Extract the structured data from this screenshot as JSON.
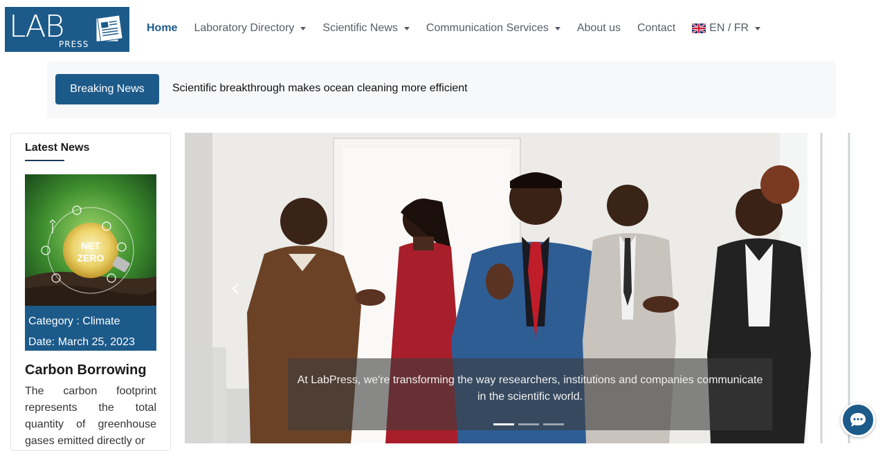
{
  "logo": {
    "letters": "LAB",
    "sub": "PRESS"
  },
  "nav": {
    "home": "Home",
    "laboratory_directory": "Laboratory Directory",
    "scientific_news": "Scientific News",
    "communication_services": "Communication Services",
    "about": "About us",
    "contact": "Contact",
    "language": "EN / FR"
  },
  "breaking": {
    "label": "Breaking News",
    "headline": "Scientific breakthrough makes ocean cleaning more efficient"
  },
  "sidebar": {
    "title": "Latest News",
    "card": {
      "image_text_1": "NET",
      "image_text_2": "ZERO",
      "category": "Category : Climate",
      "date": "Date: March 25, 2023",
      "title": "Carbon Borrowing",
      "description": "The carbon footprint represents the total quantity of greenhouse gases emitted directly or"
    }
  },
  "carousel": {
    "caption": "At LabPress, we're transforming the way researchers, institutions and companies communicate in the scientific world.",
    "prev_glyph": "‹",
    "next_glyph": "›",
    "slide_count": 3,
    "active_slide": 1
  },
  "colors": {
    "brand": "#1c5a8a",
    "nav_text": "#555e66",
    "breaking_bg": "#f7f8fa"
  },
  "icons": {
    "chat": "chat-bubble-icon",
    "flag": "uk-flag-icon"
  }
}
